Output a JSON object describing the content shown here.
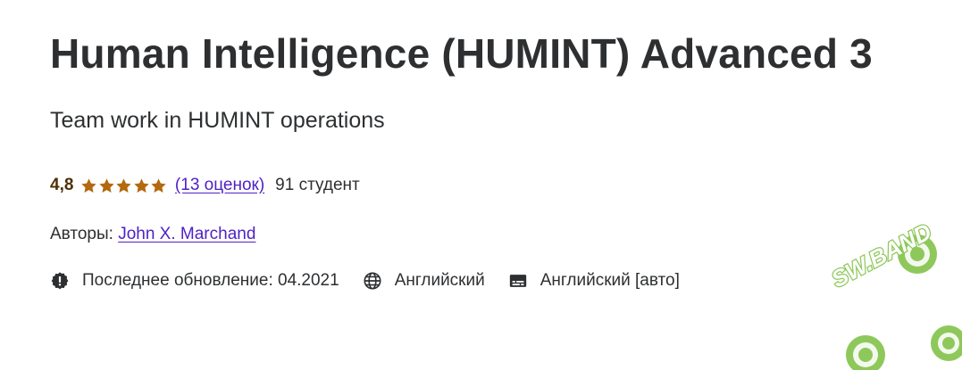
{
  "course": {
    "title": "Human Intelligence (HUMINT) Advanced 3",
    "subtitle": "Team work in HUMINT operations"
  },
  "rating": {
    "value": "4,8",
    "stars": 5,
    "count_label": "(13 оценок)",
    "students": "91 студент",
    "star_color": "#b4690e"
  },
  "authors": {
    "label": "Авторы:",
    "name": "John X. Marchand"
  },
  "meta": {
    "updated": "Последнее обновление: 04.2021",
    "language": "Английский",
    "captions": "Английский [авто]",
    "icons": {
      "updated": "alert-badge-icon",
      "language": "globe-icon",
      "captions": "closed-captions-icon"
    }
  },
  "colors": {
    "text": "#2d2f31",
    "link": "#5022c3",
    "rating": "#4d3105",
    "watermark_green": "#7bbf3f"
  },
  "watermark": {
    "text": "SW.BAND"
  }
}
